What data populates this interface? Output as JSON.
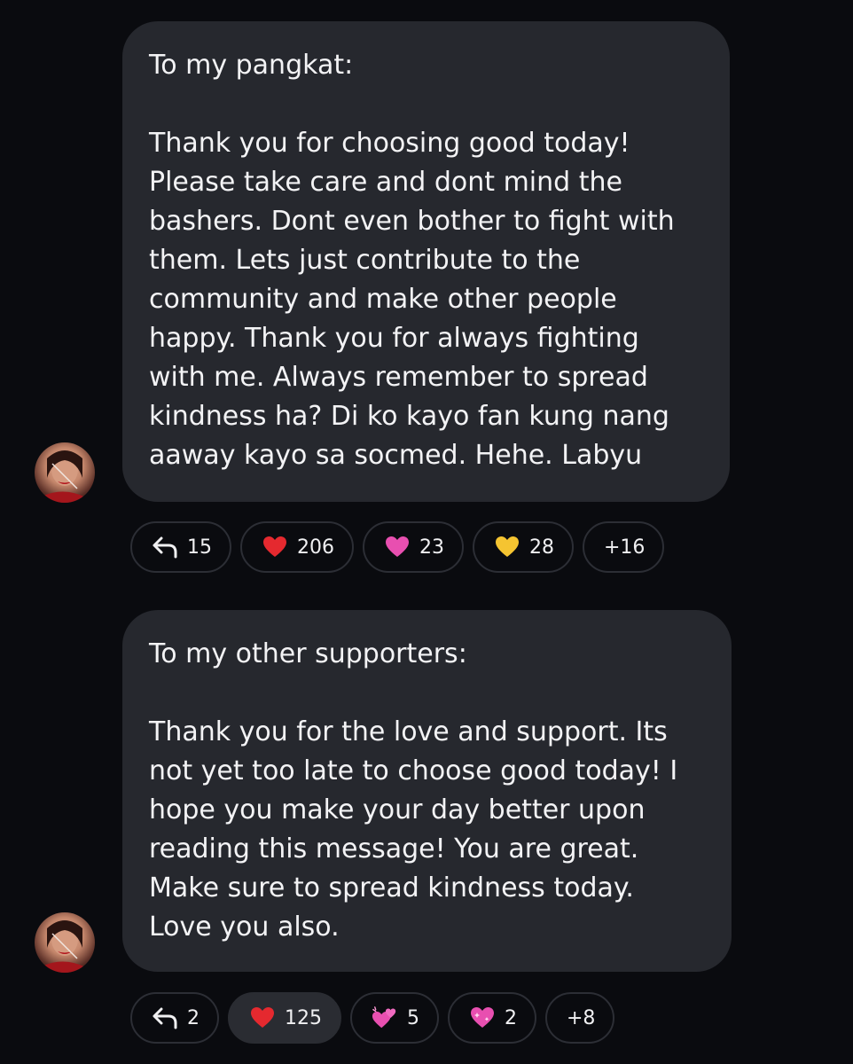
{
  "messages": [
    {
      "greeting": "To my pangkat:",
      "body": "Thank you for choosing good today!\nPlease take care and dont mind the\nbashers. Dont even bother to fight with\nthem. Lets just contribute to the\ncommunity and make other people\nhappy. Thank you for always fighting\nwith me. Always remember to spread\nkindness ha? Di ko kayo fan kung nang\naaway kayo sa socmed. Hehe. Labyu",
      "reactions": {
        "replies": "15",
        "heart": "206",
        "pink_heart": "23",
        "yellow_heart": "28",
        "more": "+16"
      }
    },
    {
      "greeting": "To my other supporters:",
      "body": "Thank you for the love and support. Its\nnot yet too late to choose good today! I\nhope you make your day better upon\nreading this message! You are great.\nMake sure to spread kindness today.\nLove you also.",
      "reactions": {
        "replies": "2",
        "heart": "125",
        "two_hearts": "5",
        "sparkling_heart": "2",
        "more": "+8"
      }
    }
  ],
  "icons": {
    "reply": "reply-arrow-icon",
    "heart": "red-heart-emoji",
    "pink_heart": "pink-heart-emoji",
    "yellow_heart": "yellow-heart-emoji",
    "two_hearts": "two-hearts-emoji",
    "sparkling_heart": "sparkling-heart-emoji"
  },
  "colors": {
    "background": "#0a0b0f",
    "bubble": "#26282e",
    "pill_border": "#2c2e35",
    "pill_active": "#2a2c32",
    "text": "#f3f3f5",
    "red_heart": "#e5292f",
    "pink_heart": "#e84fb0",
    "yellow_heart": "#f5c431"
  }
}
